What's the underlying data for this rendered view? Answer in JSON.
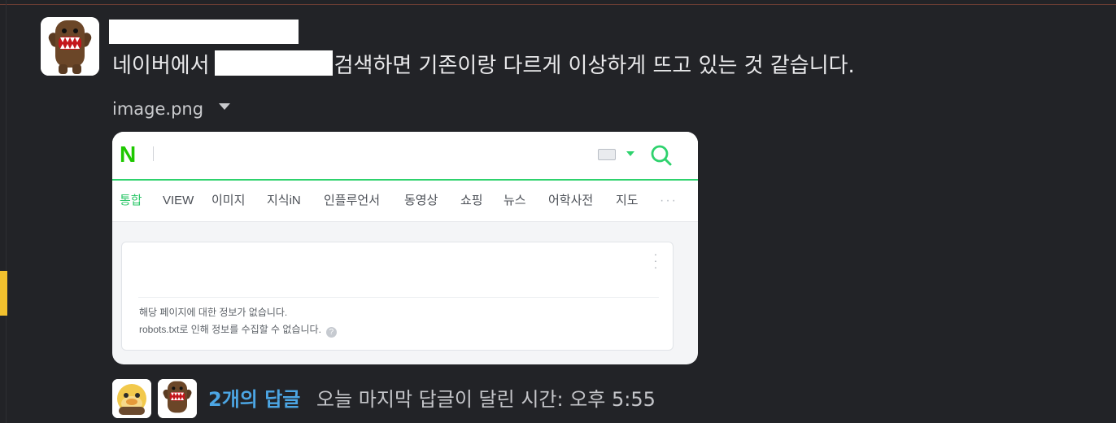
{
  "message": {
    "text_before": "네이버에서",
    "text_after": "검색하면 기존이랑 다르게 이상하게 뜨고 있는 것 같습니다.",
    "avatar_icon": "domo-avatar-icon"
  },
  "attachment": {
    "file_name": "image.png"
  },
  "screenshot": {
    "logo": "N",
    "tabs": [
      "통합",
      "VIEW",
      "이미지",
      "지식iN",
      "인플루언서",
      "동영상",
      "쇼핑",
      "뉴스",
      "어학사전",
      "지도"
    ],
    "more": "···",
    "card_line1": "해당 페이지에 대한 정보가 없습니다.",
    "card_line2": "robots.txt로 인해 정보를 수집할 수 없습니다.",
    "help": "?",
    "accent_color": "#2ed26d"
  },
  "thread": {
    "reply_count": "2개의 답글",
    "last_reply": "오늘 마지막 답글이 달린 시간: 오후 5:55"
  },
  "colors": {
    "background": "#222327",
    "link": "#4ca6e4",
    "marker": "#f2c12e"
  }
}
